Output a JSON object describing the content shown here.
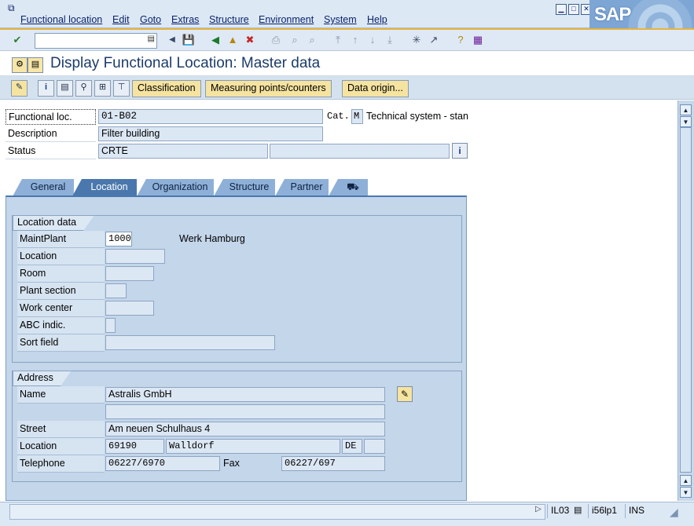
{
  "menu": {
    "items": [
      "Functional location",
      "Edit",
      "Goto",
      "Extras",
      "Structure",
      "Environment",
      "System",
      "Help"
    ],
    "logo": "SAP"
  },
  "toolbar": {
    "icons": [
      "enter-icon",
      "back-icon",
      "exit-icon",
      "cancel-icon",
      "print-icon",
      "find-icon",
      "find-next-icon",
      "first-page-icon",
      "prev-page-icon",
      "next-page-icon",
      "last-page-icon",
      "new-session-icon",
      "shortcut-icon",
      "help-icon",
      "layout-icon"
    ]
  },
  "title": "Display Functional Location: Master data",
  "app_toolbar": {
    "classification": "Classification",
    "measuring_points": "Measuring points/counters",
    "data_origin": "Data origin..."
  },
  "header": {
    "func_loc_label": "Functional loc.",
    "func_loc_value": "01-B02",
    "cat_label": "Cat.",
    "cat_value": "M",
    "cat_text": "Technical system - stan",
    "description_label": "Description",
    "description_value": "Filter building",
    "status_label": "Status",
    "status_value": "CRTE"
  },
  "tabs": [
    {
      "label": "General",
      "active": false
    },
    {
      "label": "Location",
      "active": true
    },
    {
      "label": "Organization",
      "active": false
    },
    {
      "label": "Structure",
      "active": false
    },
    {
      "label": "Partner",
      "active": false
    }
  ],
  "location_data": {
    "title": "Location data",
    "maint_plant_label": "MaintPlant",
    "maint_plant_value": "1000",
    "maint_plant_text": "Werk Hamburg",
    "location_label": "Location",
    "room_label": "Room",
    "plant_section_label": "Plant section",
    "work_center_label": "Work center",
    "abc_label": "ABC indic.",
    "sort_label": "Sort field"
  },
  "address": {
    "title": "Address",
    "name_label": "Name",
    "name_value": "Astralis GmbH",
    "street_label": "Street",
    "street_value": "Am neuen Schulhaus 4",
    "location_label": "Location",
    "postal_code": "69190",
    "city": "Walldorf",
    "country": "DE",
    "telephone_label": "Telephone",
    "telephone_value": "06227/6970",
    "fax_label": "Fax",
    "fax_value": "06227/697"
  },
  "statusbar": {
    "transaction": "IL03",
    "server": "i56lp1",
    "mode": "INS"
  }
}
